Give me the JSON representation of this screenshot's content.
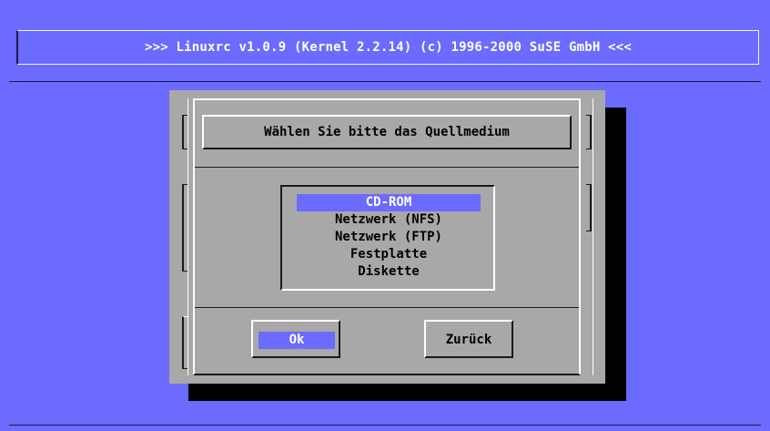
{
  "banner": {
    "title": ">>> Linuxrc v1.0.9 (Kernel 2.2.14) (c) 1996-2000 SuSE GmbH <<<"
  },
  "dialog": {
    "title": "Wählen Sie bitte das Quellmedium",
    "options": [
      {
        "label": "CD-ROM",
        "selected": true
      },
      {
        "label": "Netzwerk (NFS)",
        "selected": false
      },
      {
        "label": "Netzwerk (FTP)",
        "selected": false
      },
      {
        "label": "Festplatte",
        "selected": false
      },
      {
        "label": "Diskette",
        "selected": false
      }
    ],
    "ok_label": "Ok",
    "back_label": "Zurück"
  },
  "colors": {
    "background": "#6b6bff",
    "dialog": "#a8a8a8",
    "highlight": "#6b6bff",
    "shadow": "#000000"
  }
}
